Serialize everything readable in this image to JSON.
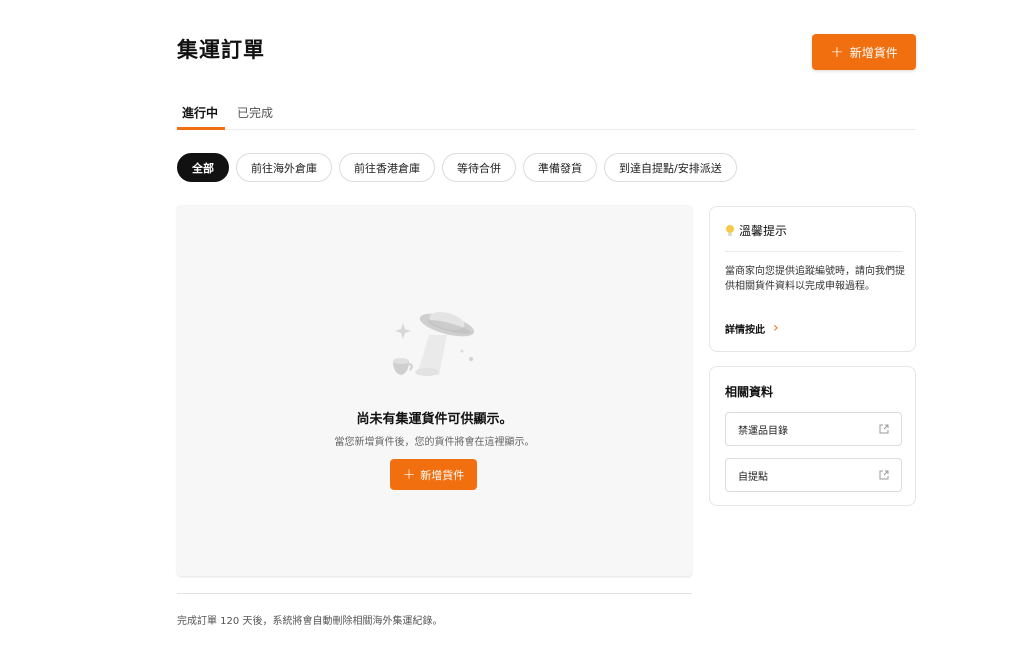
{
  "header": {
    "title": "集運訂單",
    "add_button_label": "新增貨件",
    "add_button_icon": "plus-icon"
  },
  "tabs": [
    {
      "label": "進行中",
      "active": true
    },
    {
      "label": "已完成",
      "active": false
    }
  ],
  "filters": [
    {
      "label": "全部",
      "active": true
    },
    {
      "label": "前往海外倉庫",
      "active": false
    },
    {
      "label": "前往香港倉庫",
      "active": false
    },
    {
      "label": "等待合併",
      "active": false
    },
    {
      "label": "準備發貨",
      "active": false
    },
    {
      "label": "到達自提點/安排派送",
      "active": false
    }
  ],
  "empty_state": {
    "illustration": "ufo-icon",
    "title": "尚未有集運貨件可供顯示。",
    "description": "當您新增貨件後，您的貨件將會在這裡顯示。",
    "button_label": "新增貨件"
  },
  "footer_note": "完成訂單 120 天後，系統將會自動刪除相關海外集運紀錄。",
  "tips": {
    "icon": "lightbulb-icon",
    "title": "溫馨提示",
    "body": "當商家向您提供追蹤編號時，請向我們提供相關貨件資料以完成申報過程。",
    "link_label": "詳情按此"
  },
  "resources": {
    "title": "相關資料",
    "items": [
      {
        "label": "禁運品目錄",
        "icon": "external-link-icon"
      },
      {
        "label": "自提點",
        "icon": "external-link-icon"
      }
    ]
  },
  "colors": {
    "accent": "#f26f0f",
    "chip_active": "#111111",
    "panel_bg": "#f7f7f7"
  }
}
